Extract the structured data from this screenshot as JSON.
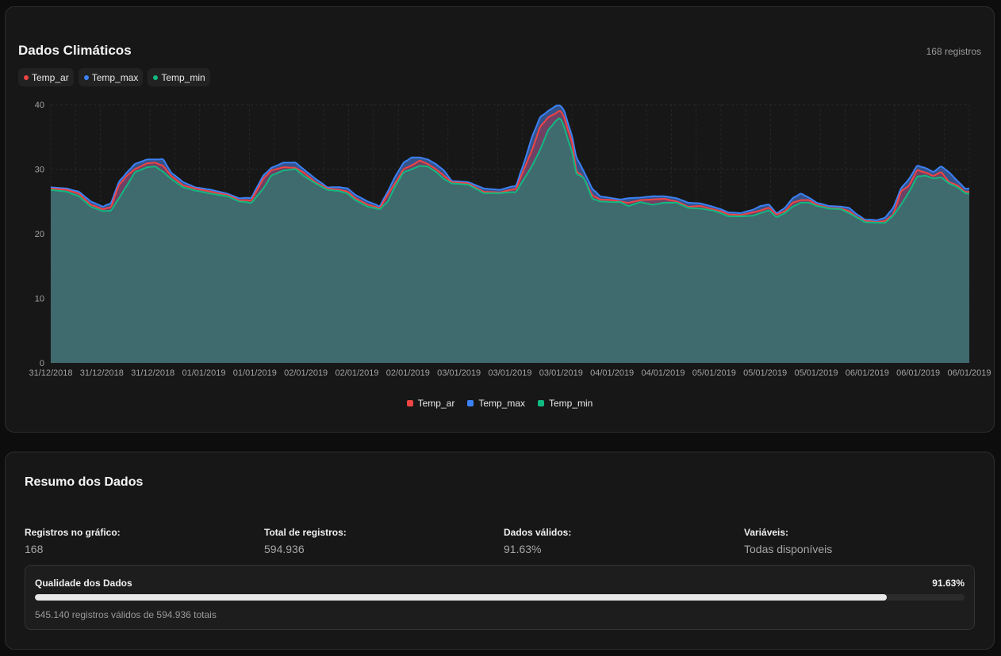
{
  "chart_card": {
    "title": "Dados Climáticos",
    "record_count": "168 registros",
    "chips": [
      {
        "label": "Temp_ar",
        "color": "#ef4444"
      },
      {
        "label": "Temp_max",
        "color": "#3b82f6"
      },
      {
        "label": "Temp_min",
        "color": "#10b981"
      }
    ]
  },
  "chart_data": {
    "type": "area",
    "title": "Dados Climáticos",
    "xlabel": "",
    "ylabel": "",
    "ylim": [
      0,
      40
    ],
    "yticks": [
      0,
      10,
      20,
      30,
      40
    ],
    "grid": true,
    "legend_position": "bottom",
    "x_tick_labels": [
      "31/12/2018",
      "31/12/2018",
      "31/12/2018",
      "01/01/2019",
      "01/01/2019",
      "02/01/2019",
      "02/01/2019",
      "02/01/2019",
      "03/01/2019",
      "03/01/2019",
      "03/01/2019",
      "04/01/2019",
      "04/01/2019",
      "05/01/2019",
      "05/01/2019",
      "05/01/2019",
      "06/01/2019",
      "06/01/2019",
      "06/01/2019"
    ],
    "x_count": 168,
    "series": [
      {
        "name": "Temp_ar",
        "color": "#ef4444",
        "keypoints": [
          [
            0,
            27
          ],
          [
            4,
            26.8
          ],
          [
            7,
            26.2
          ],
          [
            10,
            24.5
          ],
          [
            13,
            23.8
          ],
          [
            15,
            24.2
          ],
          [
            17,
            27.5
          ],
          [
            19,
            29
          ],
          [
            21,
            30
          ],
          [
            24,
            30.9
          ],
          [
            26,
            31
          ],
          [
            28,
            30.5
          ],
          [
            30,
            29
          ],
          [
            33,
            27.5
          ],
          [
            36,
            27
          ],
          [
            40,
            26.5
          ],
          [
            44,
            26
          ],
          [
            47,
            25.2
          ],
          [
            50,
            25.2
          ],
          [
            53,
            28.5
          ],
          [
            55,
            29.8
          ],
          [
            58,
            30.3
          ],
          [
            61,
            30.2
          ],
          [
            63,
            29.5
          ],
          [
            66,
            28
          ],
          [
            69,
            27
          ],
          [
            72,
            26.8
          ],
          [
            74,
            26.5
          ],
          [
            76,
            25.5
          ],
          [
            79,
            24.5
          ],
          [
            82,
            24
          ],
          [
            84,
            26
          ],
          [
            86,
            28
          ],
          [
            88,
            30
          ],
          [
            90,
            30.6
          ],
          [
            92,
            31.3
          ],
          [
            94,
            30.8
          ],
          [
            96,
            30
          ],
          [
            98,
            29
          ],
          [
            100,
            28
          ],
          [
            104,
            27.8
          ],
          [
            108,
            26.5
          ],
          [
            112,
            26.4
          ],
          [
            116,
            27
          ],
          [
            118,
            30
          ],
          [
            120,
            33
          ],
          [
            122,
            36.5
          ],
          [
            124,
            38
          ],
          [
            126,
            38.7
          ],
          [
            127,
            39
          ],
          [
            128,
            38
          ],
          [
            130,
            34
          ],
          [
            131,
            30
          ],
          [
            133,
            28.5
          ],
          [
            135,
            26
          ],
          [
            137,
            25.3
          ],
          [
            140,
            25.2
          ],
          [
            142,
            25
          ],
          [
            144,
            24.8
          ],
          [
            147,
            25.2
          ],
          [
            150,
            25.3
          ],
          [
            153,
            25.4
          ],
          [
            156,
            25
          ],
          [
            159,
            24.2
          ],
          [
            162,
            24.3
          ],
          [
            165,
            23.8
          ],
          [
            167,
            23.5
          ],
          [
            169,
            23
          ],
          [
            172,
            22.9
          ],
          [
            175,
            23.3
          ],
          [
            177,
            23.6
          ],
          [
            179,
            24
          ],
          [
            181,
            23
          ],
          [
            183,
            23.5
          ],
          [
            185,
            24.8
          ],
          [
            187,
            25.2
          ],
          [
            189,
            25.2
          ],
          [
            191,
            24.5
          ],
          [
            194,
            24
          ],
          [
            197,
            23.9
          ],
          [
            199,
            23.5
          ],
          [
            201,
            22.6
          ],
          [
            203,
            22
          ],
          [
            206,
            21.8
          ],
          [
            208,
            22
          ],
          [
            210,
            23
          ],
          [
            212,
            26.5
          ],
          [
            214,
            27.5
          ],
          [
            216,
            29.8
          ],
          [
            218,
            29.5
          ],
          [
            220,
            29
          ],
          [
            222,
            29.5
          ],
          [
            224,
            28
          ],
          [
            226,
            27.5
          ],
          [
            228,
            26.5
          ],
          [
            229,
            26.5
          ]
        ]
      },
      {
        "name": "Temp_max",
        "color": "#3b82f6",
        "keypoints": [
          [
            0,
            27.2
          ],
          [
            4,
            27
          ],
          [
            7,
            26.5
          ],
          [
            10,
            25
          ],
          [
            13,
            24.2
          ],
          [
            15,
            24.8
          ],
          [
            17,
            28
          ],
          [
            19,
            29.5
          ],
          [
            21,
            30.8
          ],
          [
            24,
            31.5
          ],
          [
            26,
            31.5
          ],
          [
            28,
            31.5
          ],
          [
            30,
            29.5
          ],
          [
            33,
            28
          ],
          [
            36,
            27.2
          ],
          [
            40,
            26.8
          ],
          [
            44,
            26.2
          ],
          [
            47,
            25.5
          ],
          [
            50,
            25.6
          ],
          [
            53,
            29
          ],
          [
            55,
            30.2
          ],
          [
            58,
            31
          ],
          [
            61,
            31
          ],
          [
            63,
            30
          ],
          [
            66,
            28.5
          ],
          [
            69,
            27.2
          ],
          [
            72,
            27.2
          ],
          [
            74,
            27
          ],
          [
            76,
            26
          ],
          [
            79,
            25
          ],
          [
            82,
            24.3
          ],
          [
            84,
            26.5
          ],
          [
            86,
            29
          ],
          [
            88,
            31
          ],
          [
            90,
            31.8
          ],
          [
            92,
            31.8
          ],
          [
            94,
            31.5
          ],
          [
            96,
            30.8
          ],
          [
            98,
            29.8
          ],
          [
            100,
            28.2
          ],
          [
            104,
            28
          ],
          [
            108,
            27
          ],
          [
            112,
            26.8
          ],
          [
            116,
            27.5
          ],
          [
            118,
            31
          ],
          [
            120,
            35
          ],
          [
            122,
            38
          ],
          [
            124,
            39
          ],
          [
            126,
            39.8
          ],
          [
            127,
            39.8
          ],
          [
            128,
            39
          ],
          [
            130,
            35
          ],
          [
            131,
            32
          ],
          [
            133,
            29.5
          ],
          [
            135,
            27
          ],
          [
            137,
            25.8
          ],
          [
            140,
            25.5
          ],
          [
            142,
            25.3
          ],
          [
            144,
            25.5
          ],
          [
            147,
            25.6
          ],
          [
            150,
            25.8
          ],
          [
            153,
            25.8
          ],
          [
            156,
            25.5
          ],
          [
            159,
            24.8
          ],
          [
            162,
            24.7
          ],
          [
            165,
            24.2
          ],
          [
            167,
            23.8
          ],
          [
            169,
            23.3
          ],
          [
            172,
            23.2
          ],
          [
            175,
            23.7
          ],
          [
            177,
            24.3
          ],
          [
            179,
            24.5
          ],
          [
            181,
            23.2
          ],
          [
            183,
            24
          ],
          [
            185,
            25.5
          ],
          [
            187,
            26.2
          ],
          [
            189,
            25.6
          ],
          [
            191,
            24.8
          ],
          [
            194,
            24.3
          ],
          [
            197,
            24.2
          ],
          [
            199,
            24
          ],
          [
            201,
            23
          ],
          [
            203,
            22.2
          ],
          [
            206,
            22.1
          ],
          [
            208,
            22.5
          ],
          [
            210,
            24
          ],
          [
            212,
            27
          ],
          [
            214,
            28.5
          ],
          [
            216,
            30.5
          ],
          [
            218,
            30.2
          ],
          [
            220,
            29.6
          ],
          [
            222,
            30.4
          ],
          [
            224,
            29.5
          ],
          [
            226,
            28.2
          ],
          [
            228,
            27
          ],
          [
            229,
            27
          ]
        ]
      },
      {
        "name": "Temp_min",
        "color": "#10b981",
        "keypoints": [
          [
            0,
            26.8
          ],
          [
            4,
            26.5
          ],
          [
            7,
            25.8
          ],
          [
            10,
            24.2
          ],
          [
            13,
            23.5
          ],
          [
            15,
            23.6
          ],
          [
            17,
            25.5
          ],
          [
            19,
            27.5
          ],
          [
            21,
            29.5
          ],
          [
            24,
            30.3
          ],
          [
            26,
            30.4
          ],
          [
            28,
            29.6
          ],
          [
            30,
            28.5
          ],
          [
            33,
            27.2
          ],
          [
            36,
            26.7
          ],
          [
            40,
            26.2
          ],
          [
            44,
            25.8
          ],
          [
            47,
            25
          ],
          [
            50,
            24.8
          ],
          [
            53,
            27
          ],
          [
            55,
            29
          ],
          [
            58,
            29.8
          ],
          [
            61,
            30
          ],
          [
            63,
            29
          ],
          [
            66,
            27.8
          ],
          [
            69,
            26.8
          ],
          [
            72,
            26.6
          ],
          [
            74,
            26.2
          ],
          [
            76,
            25.2
          ],
          [
            79,
            24.2
          ],
          [
            82,
            23.8
          ],
          [
            84,
            25
          ],
          [
            86,
            27.5
          ],
          [
            88,
            29.5
          ],
          [
            90,
            30
          ],
          [
            92,
            30.5
          ],
          [
            94,
            30.4
          ],
          [
            96,
            29.6
          ],
          [
            98,
            28.5
          ],
          [
            100,
            27.8
          ],
          [
            104,
            27.6
          ],
          [
            108,
            26.3
          ],
          [
            112,
            26.3
          ],
          [
            116,
            26.5
          ],
          [
            118,
            28.5
          ],
          [
            120,
            30.5
          ],
          [
            122,
            33
          ],
          [
            124,
            36
          ],
          [
            126,
            37.5
          ],
          [
            127,
            37.8
          ],
          [
            128,
            36.5
          ],
          [
            130,
            32.5
          ],
          [
            131,
            29.5
          ],
          [
            133,
            28.5
          ],
          [
            135,
            25.5
          ],
          [
            137,
            25
          ],
          [
            140,
            24.9
          ],
          [
            142,
            24.9
          ],
          [
            144,
            24.3
          ],
          [
            147,
            24.9
          ],
          [
            150,
            24.5
          ],
          [
            153,
            24.8
          ],
          [
            156,
            24.8
          ],
          [
            159,
            24
          ],
          [
            162,
            23.9
          ],
          [
            165,
            23.6
          ],
          [
            167,
            23.2
          ],
          [
            169,
            22.7
          ],
          [
            172,
            22.7
          ],
          [
            175,
            22.8
          ],
          [
            177,
            23.2
          ],
          [
            179,
            23.6
          ],
          [
            181,
            22.6
          ],
          [
            183,
            23.2
          ],
          [
            185,
            24.2
          ],
          [
            187,
            24.8
          ],
          [
            189,
            24.8
          ],
          [
            191,
            24.3
          ],
          [
            194,
            23.9
          ],
          [
            197,
            23.8
          ],
          [
            199,
            23.2
          ],
          [
            201,
            22.5
          ],
          [
            203,
            21.8
          ],
          [
            206,
            21.7
          ],
          [
            208,
            21.7
          ],
          [
            210,
            22.8
          ],
          [
            212,
            24.5
          ],
          [
            214,
            26.5
          ],
          [
            216,
            28.8
          ],
          [
            218,
            29
          ],
          [
            220,
            28.6
          ],
          [
            222,
            28.7
          ],
          [
            224,
            27.8
          ],
          [
            226,
            27.2
          ],
          [
            228,
            26.3
          ],
          [
            229,
            26.2
          ]
        ]
      }
    ]
  },
  "legend": [
    "Temp_ar",
    "Temp_max",
    "Temp_min"
  ],
  "summary": {
    "title": "Resumo dos Dados",
    "stats": [
      {
        "label": "Registros no gráfico:",
        "value": "168"
      },
      {
        "label": "Total de registros:",
        "value": "594.936"
      },
      {
        "label": "Dados válidos:",
        "value": "91.63%"
      },
      {
        "label": "Variáveis:",
        "value": "Todas disponíveis"
      }
    ],
    "quality": {
      "label": "Qualidade dos Dados",
      "percent_text": "91.63%",
      "fraction": 0.9163,
      "note": "545.140 registros válidos de 594.936 totais"
    }
  }
}
